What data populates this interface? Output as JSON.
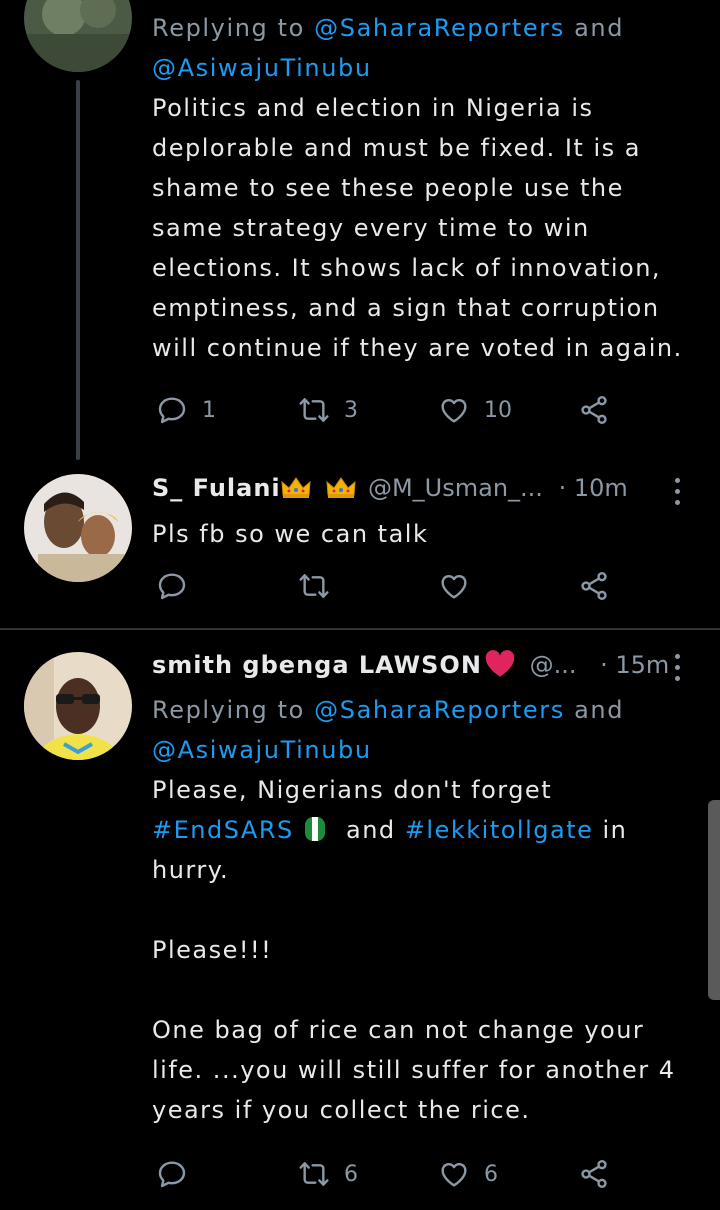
{
  "tweets": [
    {
      "reply_prefix": "Replying to",
      "mention1": "@SaharaReporters",
      "and": "and",
      "mention2": "@AsiwajuTinubu",
      "lines": [
        "Politics and election in Nigeria is",
        "deplorable and must be fixed. It is a",
        "shame to see these people use the",
        "same strategy every time to win",
        "elections. It shows lack of innovation,",
        "emptiness, and a sign that corruption",
        "will continue if they are voted in again."
      ],
      "replies": "1",
      "retweets": "3",
      "likes": "10"
    },
    {
      "name": "S_ Fulani",
      "handle": "@M_Usman_...",
      "time": "· 10m",
      "text": "Pls fb so we can talk"
    },
    {
      "name": "smith gbenga LAWSON",
      "handle": "@...",
      "time": "· 15m",
      "reply_prefix": "Replying to",
      "mention1": "@SaharaReporters",
      "and": "and",
      "mention2": "@AsiwajuTinubu",
      "line1_pre": "Please, Nigerians don't forget",
      "hashtag1": "#EndSARS",
      "and_word": "and",
      "hashtag2": "#lekkitollgate",
      "line2_post": "in",
      "line3": "hurry.",
      "line4": "Please!!!",
      "line5": "One bag of rice can not change your",
      "line6": "life. ...you will still suffer for another 4",
      "line7": "years if you collect the rice.",
      "retweets": "6",
      "likes": "6"
    }
  ],
  "icons": [
    "reply-icon",
    "retweet-icon",
    "like-icon",
    "share-icon",
    "more-icon",
    "crown-icon",
    "heart-emoji",
    "flag-emoji"
  ],
  "colors": {
    "background": "#000000",
    "link": "#1d9bf0",
    "muted": "#8b98a5",
    "heart": "#e0245e"
  }
}
